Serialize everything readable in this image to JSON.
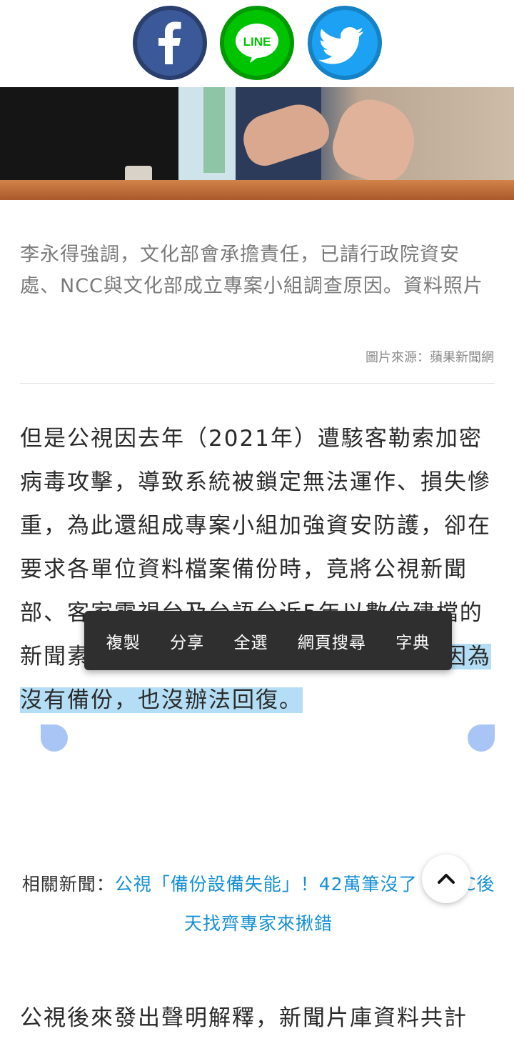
{
  "share": {
    "facebook_icon": "facebook-icon",
    "line_label": "LINE",
    "twitter_icon": "twitter-bird-icon",
    "colors": {
      "facebook": "#3b5998",
      "line": "#00c300",
      "twitter": "#1da1f2"
    }
  },
  "photo": {
    "alt": ""
  },
  "caption": {
    "text": "李永得強調，文化部會承擔責任，已請行政院資安處、NCC與文化部成立專案小組調查原因。資料照片",
    "credit": "圖片來源：蘋果新聞網"
  },
  "article": {
    "paragraph1_before": "但是公視因去年（2021年）遭駭客勒索加密病毒攻擊，導致系統被鎖定無法運作、損失慘重，為此還組成專案小組加強資安防護，卻在要求各單位資料檔案備份時，竟將公視新聞部、客家電視台及台語台近5年以數位建檔的新聞素材，硬碟中的資料全數刪除，",
    "paragraph1_selected": "而且因為沒有備份，也沒辦法回復。",
    "paragraph2": "公視後來發出聲明解釋，新聞片庫資料共計"
  },
  "context_menu": {
    "copy": "複製",
    "share": "分享",
    "select_all": "全選",
    "web_search": "網頁搜尋",
    "dictionary": "字典"
  },
  "related": {
    "label": "相關新聞：",
    "link_text": "公視「備份設備失能」！42萬筆沒了　NCC後天找齊專家來揪錯"
  },
  "selection_color": "#b4def5",
  "link_color": "#1690d5"
}
